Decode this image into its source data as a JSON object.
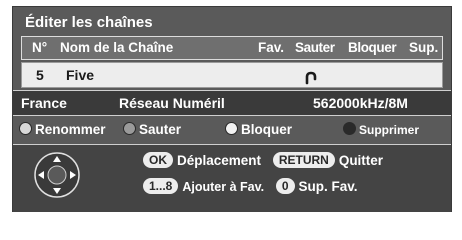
{
  "title": "Éditer les chaînes",
  "header": {
    "num": "N°",
    "name": "Nom de la Chaîne",
    "fav": "Fav.",
    "skip": "Sauter",
    "lock": "Bloquer",
    "del": "Sup."
  },
  "row": {
    "num": "5",
    "name": "Five"
  },
  "network": {
    "country": "France",
    "network": "Réseau Numéril",
    "frequency": "562000kHz/8M"
  },
  "color_keys": [
    {
      "label": "Renommer",
      "color": "#d8d8d8"
    },
    {
      "label": "Sauter",
      "color": "#9a9a9a"
    },
    {
      "label": "Bloquer",
      "color": "#f2f2f2"
    },
    {
      "label": "Supprimer",
      "color": "#2a2a2a"
    }
  ],
  "help": {
    "ok_key": "OK",
    "ok_text": "Déplacement",
    "return_key": "RETURN",
    "return_text": "Quitter",
    "fav_key": "1...8",
    "fav_text": "Ajouter à Fav.",
    "zero_key": "0",
    "zero_text": "Sup. Fav."
  },
  "icons": {
    "lock": "padlock-icon",
    "nav": "dpad-icon"
  }
}
